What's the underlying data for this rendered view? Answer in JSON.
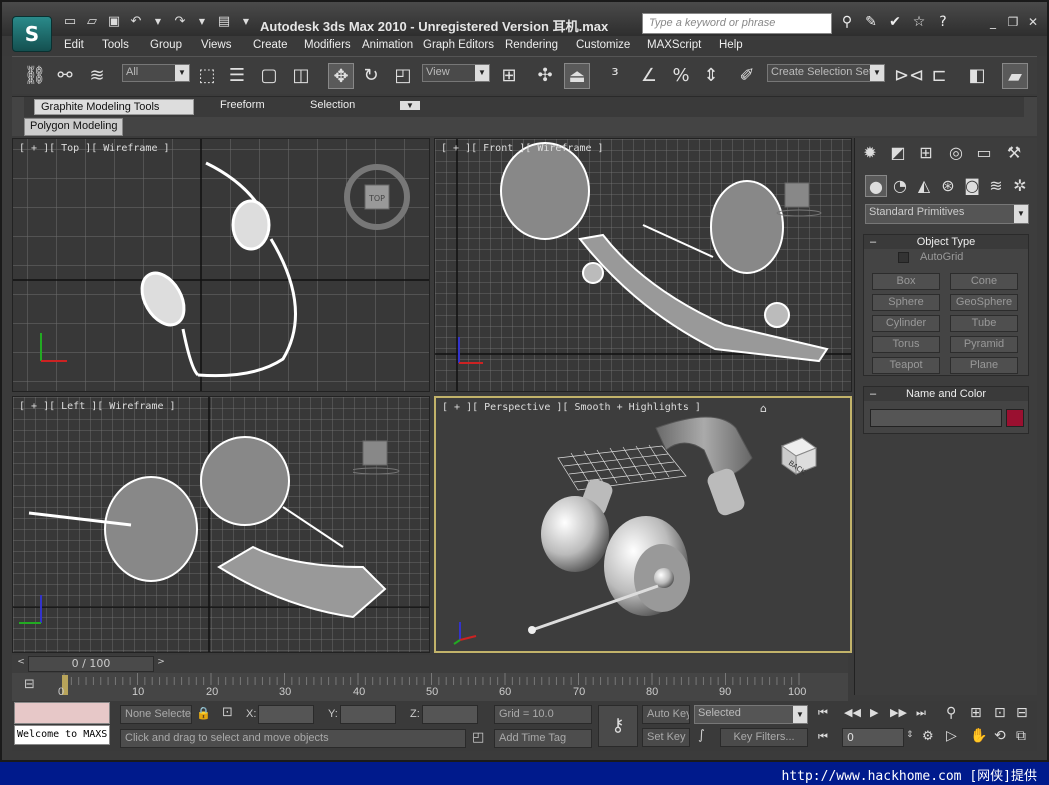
{
  "title": "Autodesk 3ds Max  2010  - Unregistered Version   耳机.max",
  "search_placeholder": "Type a keyword or phrase",
  "menu": [
    "Edit",
    "Tools",
    "Group",
    "Views",
    "Create",
    "Modifiers",
    "Animation",
    "Graph Editors",
    "Rendering",
    "Customize",
    "MAXScript",
    "Help"
  ],
  "toolbar": {
    "selection_filter": "All",
    "ref_coord": "View",
    "named_selection": "Create Selection Set"
  },
  "ribbon": {
    "tabs": [
      "Graphite Modeling Tools",
      "Freeform",
      "Selection"
    ],
    "subtab": "Polygon Modeling"
  },
  "viewports": {
    "top": "[ + ][ Top ][ Wireframe ]",
    "front": "[ + ][ Front ][ Wireframe ]",
    "left": "[ + ][ Left ][ Wireframe ]",
    "perspective": "[ + ][ Perspective ][ Smooth + Highlights ]",
    "cube_top": "TOP",
    "cube_back": "BACK"
  },
  "command_panel": {
    "category": "Standard Primitives",
    "object_type_header": "Object Type",
    "autogrid": "AutoGrid",
    "buttons": [
      "Box",
      "Cone",
      "Sphere",
      "GeoSphere",
      "Cylinder",
      "Tube",
      "Torus",
      "Pyramid",
      "Teapot",
      "Plane"
    ],
    "name_color_header": "Name and Color",
    "color": "#9a1030"
  },
  "timeline": {
    "frame": "0 / 100",
    "ticks": [
      "0",
      "10",
      "20",
      "30",
      "40",
      "50",
      "60",
      "70",
      "80",
      "90",
      "100"
    ]
  },
  "status": {
    "welcome": "Welcome to MAXS",
    "selection": "None Selected",
    "x_label": "X:",
    "y_label": "Y:",
    "z_label": "Z:",
    "grid": "Grid = 10.0",
    "hint": "Click and drag to select and move objects",
    "add_time_tag": "Add Time Tag",
    "auto_key": "Auto Key",
    "set_key": "Set Key",
    "key_mode": "Selected",
    "key_filters": "Key Filters...",
    "current_frame": "0"
  },
  "footer": "http://www.hackhome.com [网侠]提供"
}
